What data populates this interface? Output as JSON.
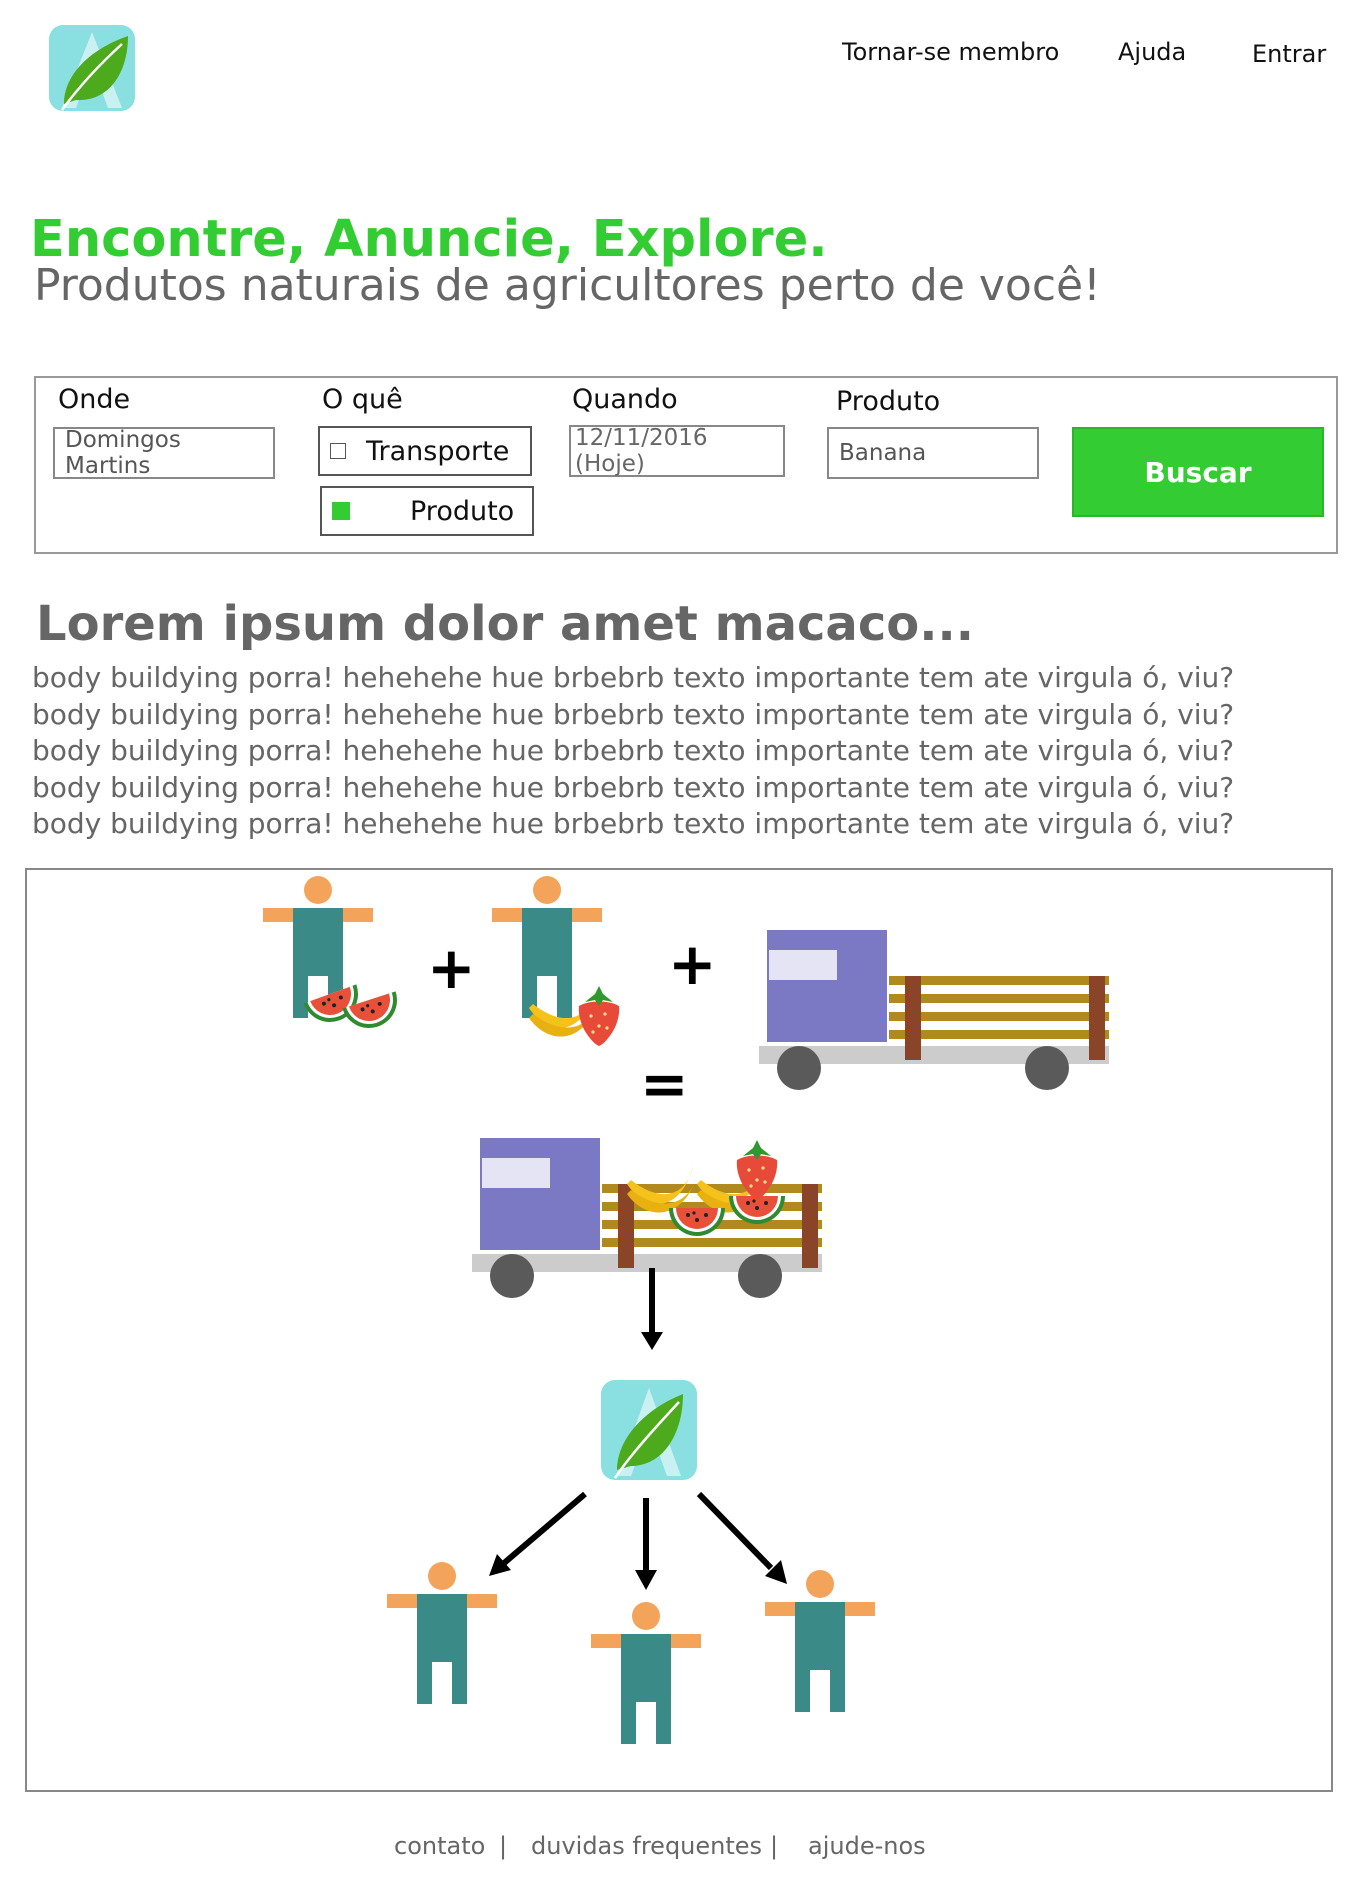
{
  "nav": {
    "become_member": "Tornar-se membro",
    "help": "Ajuda",
    "login": "Entrar"
  },
  "hero": {
    "headline": "Encontre, Anuncie, Explore.",
    "subline": "Produtos naturais de agricultores perto de você!"
  },
  "search": {
    "where_label": "Onde",
    "where_value": "Domingos Martins",
    "what_label": "O quê",
    "what_options": [
      {
        "label": "Transporte",
        "checked": false
      },
      {
        "label": "Produto",
        "checked": true
      }
    ],
    "when_label": "Quando",
    "when_value": "12/11/2016 (Hoje)",
    "product_label": "Produto",
    "product_value": "Banana",
    "search_button": "Buscar"
  },
  "content": {
    "title": "Lorem ipsum dolor amet macaco...",
    "lines": [
      "body buildying porra! hehehehe hue brbebrb texto importante tem ate virgula ó, viu?",
      "body buildying porra! hehehehe hue brbebrb texto importante tem ate virgula ó, viu?",
      "body buildying porra! hehehehe hue brbebrb texto importante tem ate virgula ó, viu?",
      "body buildying porra! hehehehe hue brbebrb texto importante tem ate virgula ó, viu?",
      "body buildying porra! hehehehe hue brbebrb texto importante tem ate virgula ó, viu?"
    ]
  },
  "diagram": {
    "plus_sign": "+",
    "equals_sign": "="
  },
  "footer": {
    "contact": "contato",
    "faq": "duvidas frequentes",
    "help_us": "ajude-nos",
    "separator": "|"
  },
  "colors": {
    "accent": "#33cc33",
    "logo_bg": "#8ae0e0",
    "leaf": "#4caa1c",
    "person_body": "#3a8a88",
    "person_skin": "#f4a45a",
    "truck_cab": "#7b78c4",
    "truck_wood": "#b08a1e",
    "truck_post": "#8a4528"
  }
}
